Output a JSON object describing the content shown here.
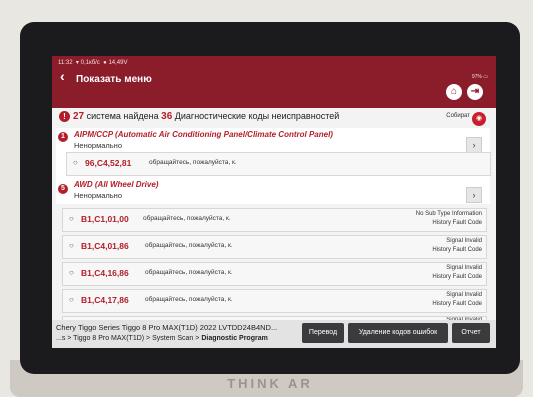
{
  "status_bar": {
    "time": "11:32",
    "net": "0,1кб/с",
    "voltage": "14,49V",
    "battery": "97%"
  },
  "header": {
    "back_icon": "chevron-left-icon",
    "title": "Показать меню"
  },
  "summary": {
    "systems_count": "27",
    "systems_text": "система найдена",
    "codes_count": "36",
    "codes_text": "Диагностические коды неисправностей",
    "collect_label": "Собират"
  },
  "modules": [
    {
      "badge": "1",
      "name": "AIPM/CCP (Automatic Air Conditioning Panel/Climate Control Panel)",
      "status": "Ненормально"
    },
    {
      "badge": "5",
      "name": "AWD (All Wheel Drive)",
      "status": "Ненормально"
    }
  ],
  "dtcs": [
    {
      "code": "96,C4,52,81",
      "desc": "обращайтесь, пожалуйста, к.",
      "status1": "",
      "status2": ""
    },
    {
      "code": "B1,C1,01,00",
      "desc": "обращайтесь, пожалуйста, к.",
      "status1": "No Sub Type Information",
      "status2": "History Fault Code"
    },
    {
      "code": "B1,C4,01,86",
      "desc": "обращайтесь, пожалуйста, к.",
      "status1": "Signal Invalid",
      "status2": "History Fault Code"
    },
    {
      "code": "B1,C4,16,86",
      "desc": "обращайтесь, пожалуйста, к.",
      "status1": "Signal Invalid",
      "status2": "History Fault Code"
    },
    {
      "code": "B1,C4,17,86",
      "desc": "обращайтесь, пожалуйста, к.",
      "status1": "Signal Invalid",
      "status2": "History Fault Code"
    }
  ],
  "peek_text": "Signal Invalid",
  "footer": {
    "vehicle_line": "Chery  Tiggo Series Tiggo 8 Pro MAX(T1D) 2022  LVTDD24B4ND...",
    "path_prefix": "...s > Tiggo 8 Pro MAX(T1D) > System Scan > ",
    "path_current": "Diagnostic Program",
    "translate_label": "Перевод",
    "clear_label": "Удаление кодов ошибок",
    "report_label": "Отчет"
  },
  "device_brand": "THINK AR",
  "colors": {
    "header": "#8b1d2b",
    "accent_red": "#b21e2a",
    "footer_button": "#3b3b3d"
  }
}
